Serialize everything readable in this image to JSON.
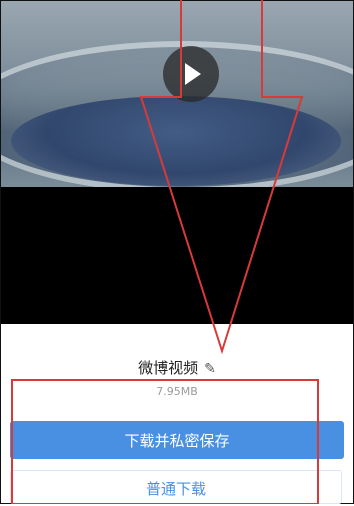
{
  "video": {
    "play_icon": "play-icon"
  },
  "sheet": {
    "title": "微博视频",
    "edit_icon": "pencil-icon",
    "edit_glyph": "✎",
    "file_size": "7.95MB",
    "primary_button": "下载并私密保存",
    "secondary_button": "普通下载"
  },
  "colors": {
    "accent": "#4a90e2",
    "annotation": "#d83a3a"
  }
}
